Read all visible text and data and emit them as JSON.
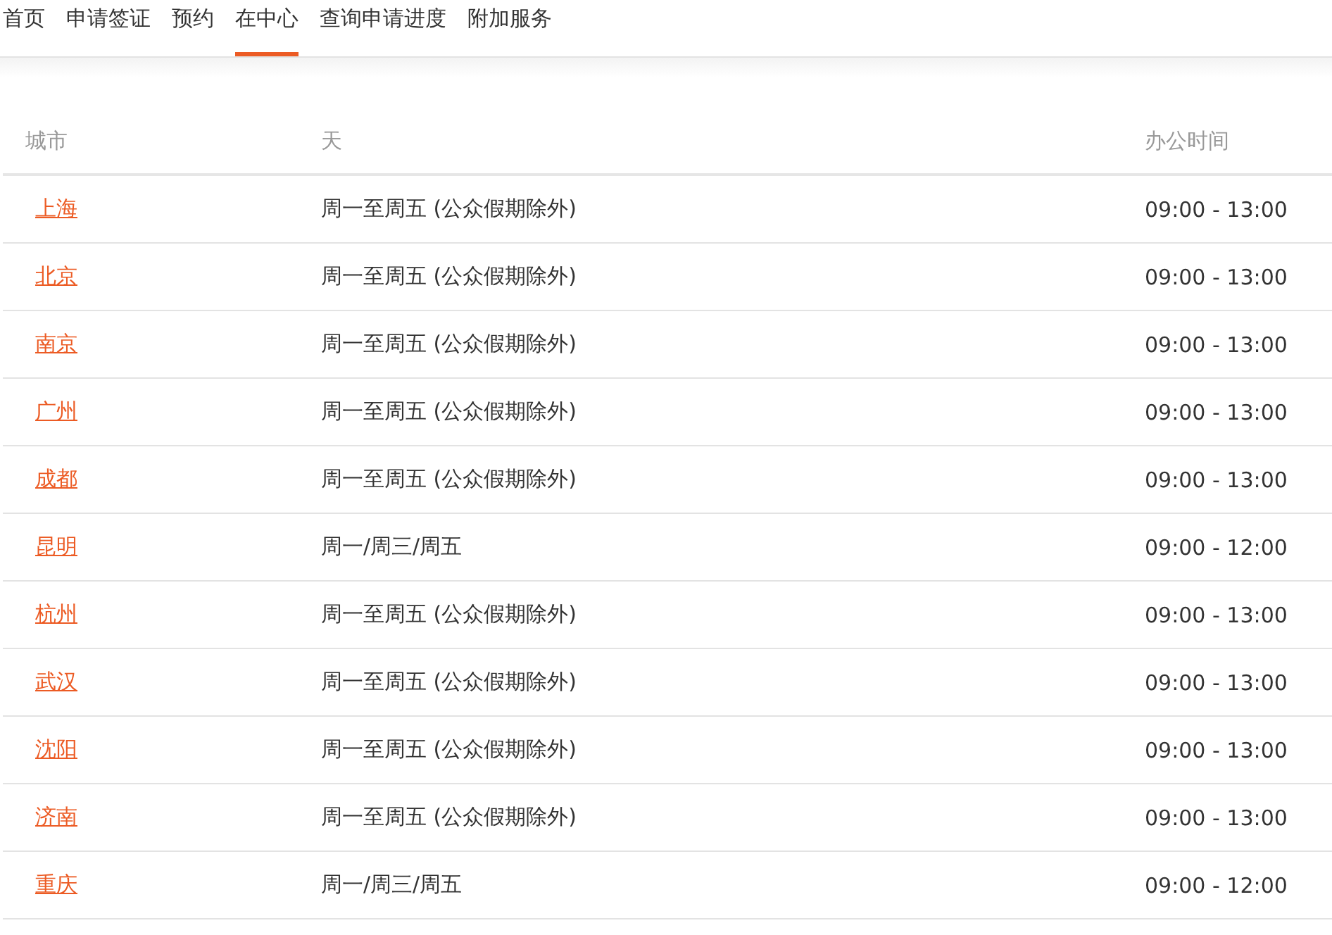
{
  "nav": {
    "tabs": [
      {
        "label": "首页",
        "selected": false
      },
      {
        "label": "申请签证",
        "selected": false
      },
      {
        "label": "预约",
        "selected": false
      },
      {
        "label": "在中心",
        "selected": true
      },
      {
        "label": "查询申请进度",
        "selected": false
      },
      {
        "label": "附加服务",
        "selected": false
      }
    ]
  },
  "table": {
    "columns": [
      "城市",
      "天",
      "办公时间"
    ],
    "rows": [
      {
        "city": "上海",
        "days": "周一至周五 (公众假期除外)",
        "hours": "09:00 - 13:00"
      },
      {
        "city": "北京",
        "days": "周一至周五 (公众假期除外)",
        "hours": "09:00 - 13:00"
      },
      {
        "city": "南京",
        "days": "周一至周五 (公众假期除外)",
        "hours": "09:00 - 13:00"
      },
      {
        "city": "广州",
        "days": "周一至周五 (公众假期除外)",
        "hours": "09:00 - 13:00"
      },
      {
        "city": "成都",
        "days": "周一至周五 (公众假期除外)",
        "hours": "09:00 - 13:00"
      },
      {
        "city": "昆明",
        "days": "周一/周三/周五",
        "hours": "09:00 - 12:00"
      },
      {
        "city": "杭州",
        "days": "周一至周五 (公众假期除外)",
        "hours": "09:00 - 13:00"
      },
      {
        "city": "武汉",
        "days": "周一至周五 (公众假期除外)",
        "hours": "09:00 - 13:00"
      },
      {
        "city": "沈阳",
        "days": "周一至周五 (公众假期除外)",
        "hours": "09:00 - 13:00"
      },
      {
        "city": "济南",
        "days": "周一至周五 (公众假期除外)",
        "hours": "09:00 - 13:00"
      },
      {
        "city": "重庆",
        "days": "周一/周三/周五",
        "hours": "09:00 - 12:00"
      }
    ]
  }
}
